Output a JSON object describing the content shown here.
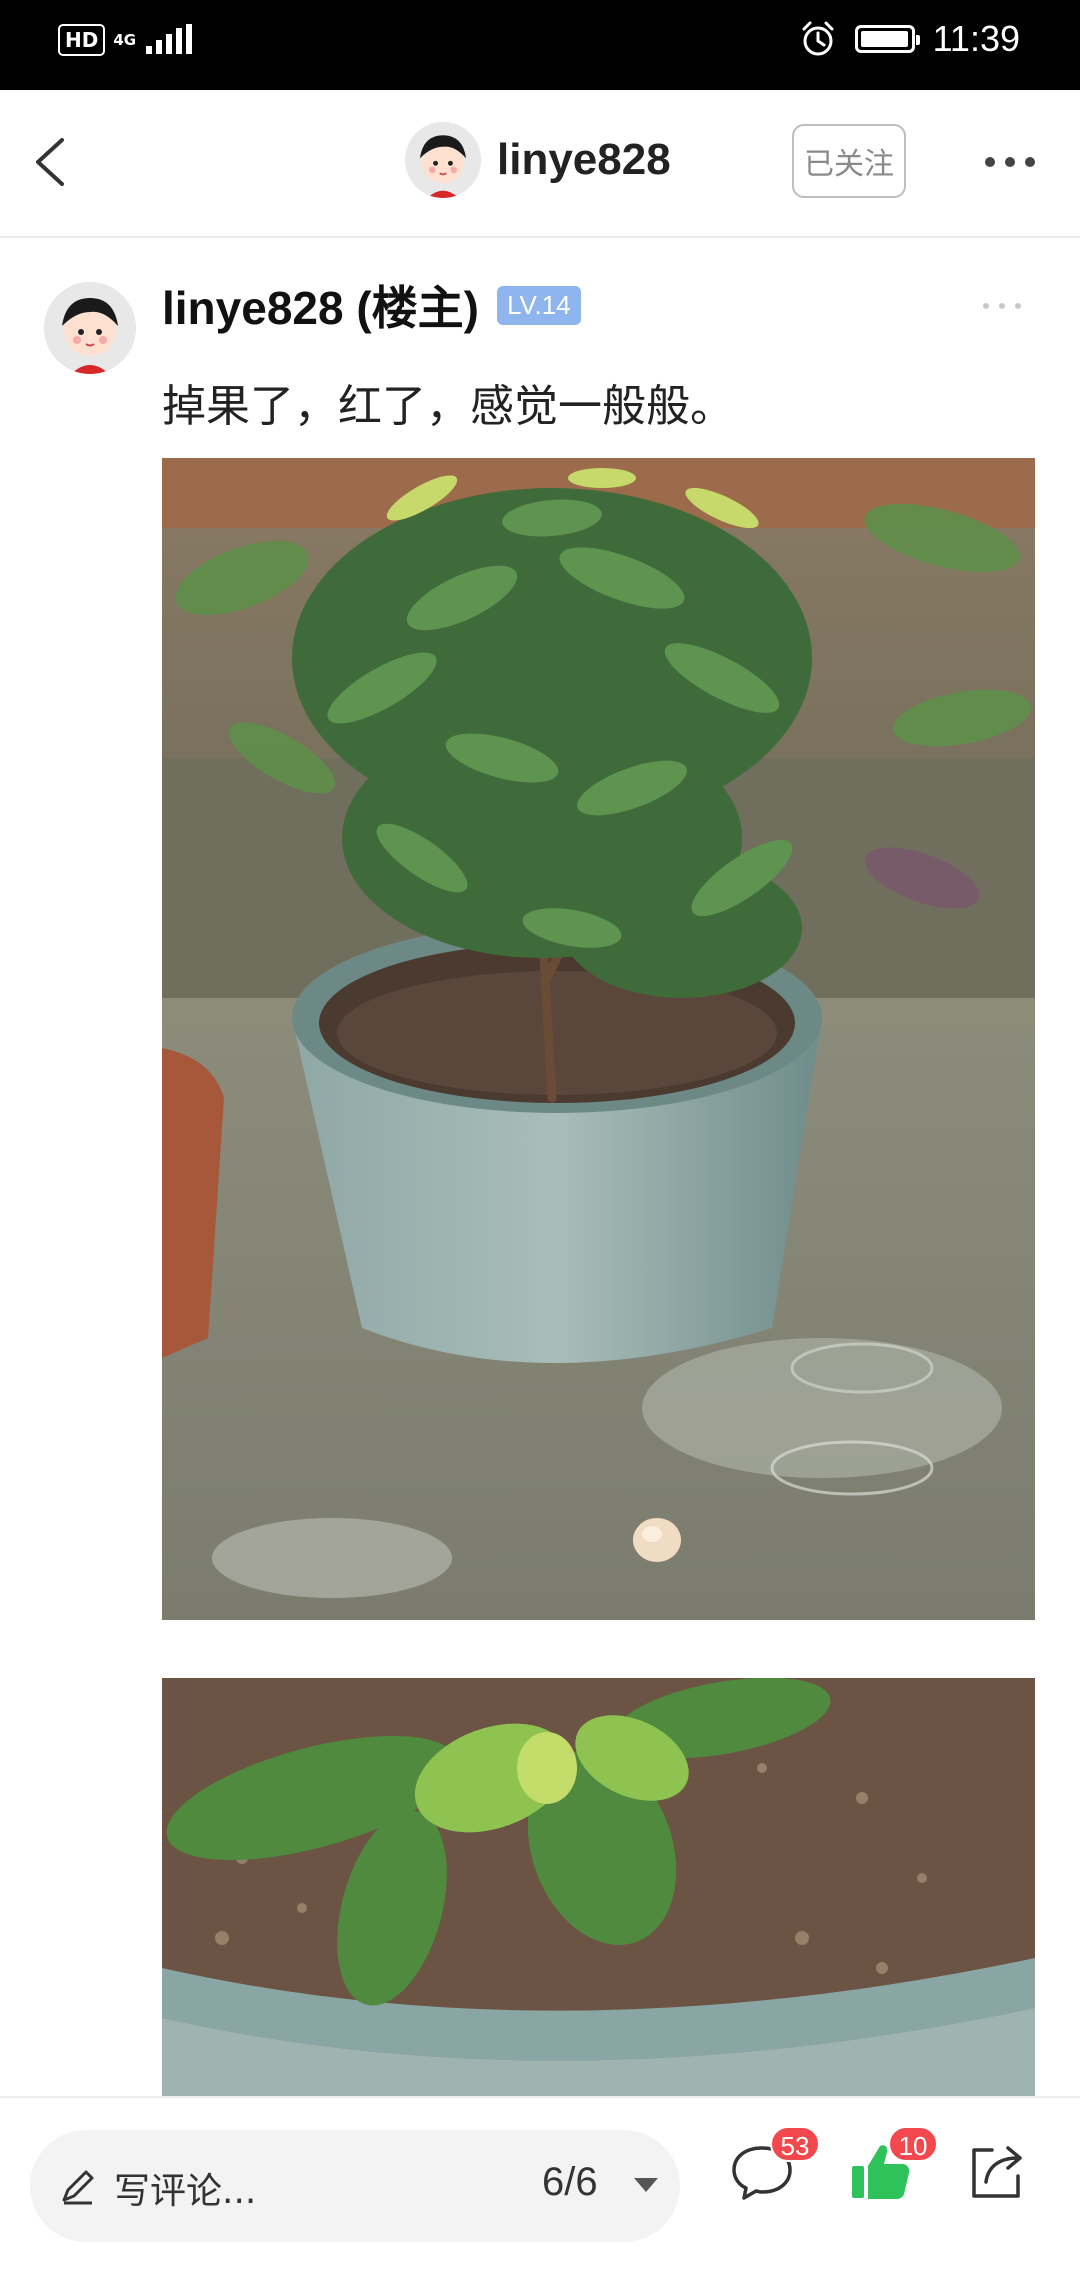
{
  "status_bar": {
    "hd": "HD",
    "network": "4G",
    "time": "11:39"
  },
  "nav": {
    "username": "linye828",
    "follow_label": "已关注"
  },
  "post": {
    "author": "linye828 (楼主)",
    "level": "LV.14",
    "text": "掉果了，红了，感觉一般般。",
    "images": [
      {
        "name": "guava-plant-in-pot"
      },
      {
        "name": "guava-pot-closeup"
      }
    ]
  },
  "bottom_bar": {
    "comment_placeholder": "写评论...",
    "page_indicator": "6/6",
    "comment_count": "53",
    "like_count": "10"
  },
  "colors": {
    "level_badge": "#8fb5ee",
    "like_green": "#2fc25b",
    "badge_red": "#f2484e"
  }
}
